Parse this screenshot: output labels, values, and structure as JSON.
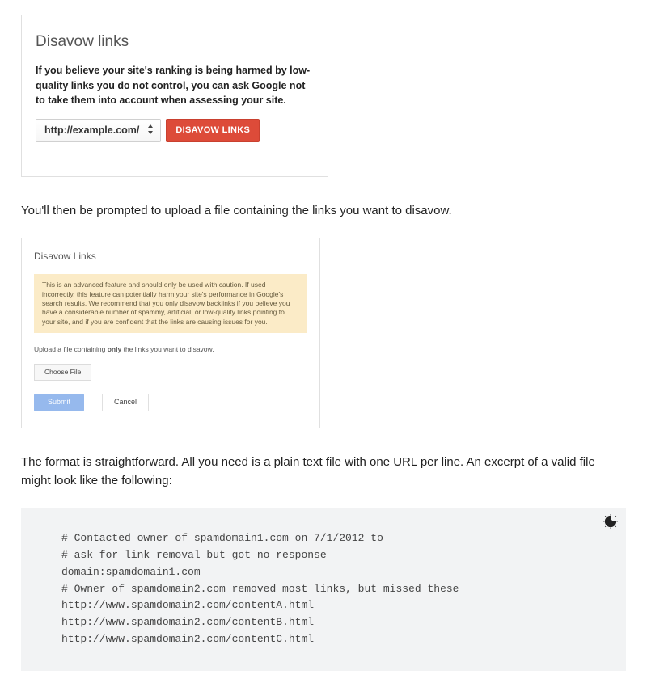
{
  "panel1": {
    "title": "Disavow links",
    "description": "If you believe your site's ranking is being harmed by low-quality links you do not control, you can ask Google not to take them into account when assessing your site.",
    "dropdown_value": "http://example.com/",
    "button_label": "DISAVOW LINKS"
  },
  "paragraph_mid": "You'll then be prompted to upload a file containing the links you want to disavow.",
  "panel2": {
    "title": "Disavow Links",
    "warning": "This is an advanced feature and should only be used with caution. If used incorrectly, this feature can potentially harm your site's performance in Google's search results. We recommend that you only disavow backlinks if you believe you have a considerable number of spammy, artificial, or low-quality links pointing to your site, and if you are confident that the links are causing issues for you.",
    "upload_instructions_prefix": "Upload a file containing ",
    "upload_instructions_bold": "only",
    "upload_instructions_suffix": " the links you want to disavow.",
    "choose_file_label": "Choose File",
    "submit_label": "Submit",
    "cancel_label": "Cancel"
  },
  "paragraph_bottom": "The format is straightforward. All you need is a plain text file with one URL per line. An excerpt of a valid file might look like the following:",
  "code_example": "# Contacted owner of spamdomain1.com on 7/1/2012 to\n# ask for link removal but got no response\ndomain:spamdomain1.com\n# Owner of spamdomain2.com removed most links, but missed these\nhttp://www.spamdomain2.com/contentA.html\nhttp://www.spamdomain2.com/contentB.html\nhttp://www.spamdomain2.com/contentC.html"
}
